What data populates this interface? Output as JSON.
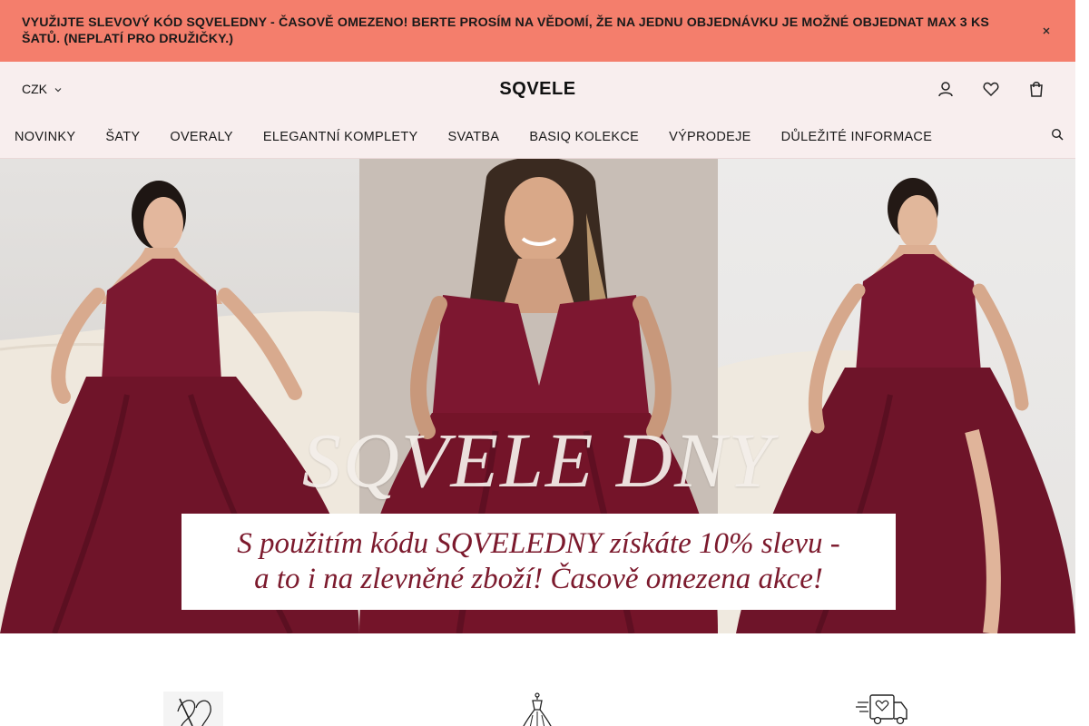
{
  "promo": {
    "message": "VYUŽIJTE SLEVOVÝ KÓD SQVELEDNY - ČASOVĚ OMEZENO! BERTE PROSÍM NA VĚDOMÍ, ŽE NA JEDNU OBJEDNÁVKU JE MOŽNÉ OBJEDNAT MAX 3 KS ŠATŮ. (NEPLATÍ PRO DRUŽIČKY.)",
    "close_icon": "close-icon",
    "background_color": "#f47e6c"
  },
  "header": {
    "currency": "CZK",
    "currency_icon": "chevron-down-icon",
    "brand": "SQVELE",
    "icons": [
      "account-icon",
      "wishlist-icon",
      "cart-icon"
    ],
    "background_color": "#f8eeee"
  },
  "nav": {
    "items": [
      {
        "label": "NOVINKY"
      },
      {
        "label": "ŠATY"
      },
      {
        "label": "OVERALY"
      },
      {
        "label": "ELEGANTNÍ KOMPLETY"
      },
      {
        "label": "SVATBA"
      },
      {
        "label": "BASIQ KOLEKCE"
      },
      {
        "label": "VÝPRODEJE"
      },
      {
        "label": "DŮLEŽITÉ INFORMACE"
      }
    ],
    "search_icon": "search-icon"
  },
  "hero": {
    "title": "SQVELE DNY",
    "line1": "S použitím kódu SQVELEDNY získáte 10% slevu -",
    "line2": "a to i na zlevněné zboží! Časově omezena akce!",
    "accent_color": "#7c1a2d"
  },
  "features": [
    {
      "icon": "sewing-needle-icon"
    },
    {
      "icon": "dress-icon"
    },
    {
      "icon": "delivery-truck-icon"
    }
  ]
}
